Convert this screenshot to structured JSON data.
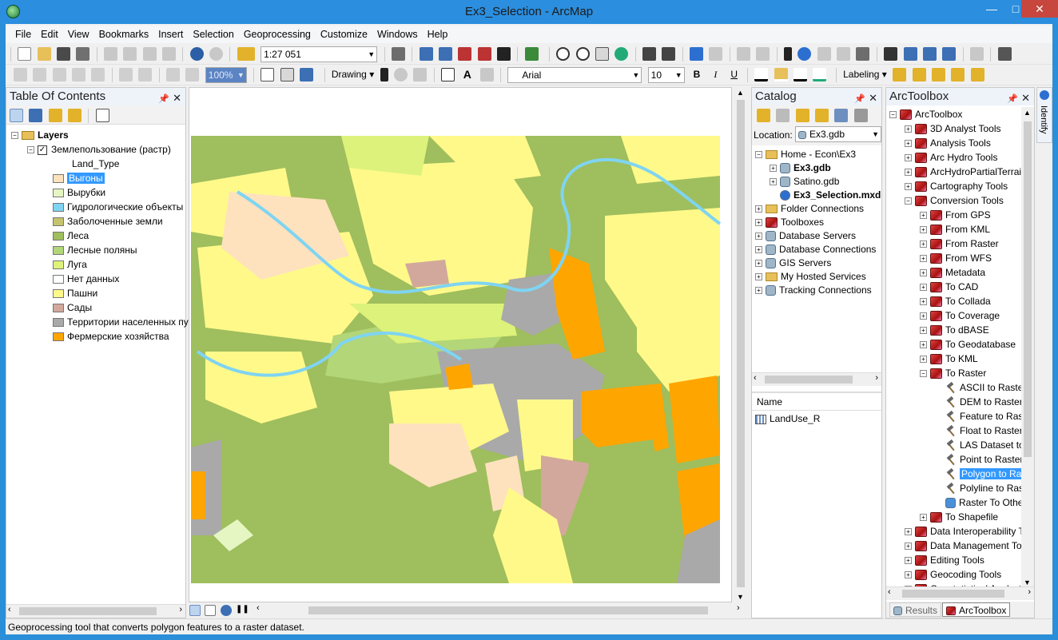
{
  "window": {
    "title": "Ex3_Selection - ArcMap",
    "minimize": "—",
    "maximize": "□",
    "close": "✕"
  },
  "menu": [
    "File",
    "Edit",
    "View",
    "Bookmarks",
    "Insert",
    "Selection",
    "Geoprocessing",
    "Customize",
    "Windows",
    "Help"
  ],
  "toolbar": {
    "scale": "1:27 051",
    "zoom_percent": "100%",
    "drawing_label": "Drawing",
    "font_name": "Arial",
    "font_size": "10",
    "bold": "B",
    "italic": "I",
    "underline": "U",
    "labeling_label": "Labeling"
  },
  "toc": {
    "title": "Table Of Contents",
    "root": "Layers",
    "layer": "Землепользование (растр)",
    "field": "Land_Type",
    "classes": [
      {
        "label": "Выгоны",
        "color": "#fde2bd"
      },
      {
        "label": "Вырубки",
        "color": "#e5f6c2"
      },
      {
        "label": "Гидрологические объекты",
        "color": "#7fd4f2"
      },
      {
        "label": "Заболоченные земли",
        "color": "#c5c46c"
      },
      {
        "label": "Леса",
        "color": "#9fbe5d"
      },
      {
        "label": "Лесные поляны",
        "color": "#b2d678"
      },
      {
        "label": "Луга",
        "color": "#ddf27a"
      },
      {
        "label": "Нет данных",
        "color": "#ffffff"
      },
      {
        "label": "Пашни",
        "color": "#fff98a"
      },
      {
        "label": "Сады",
        "color": "#d2a89c"
      },
      {
        "label": "Территории населенных пунктов",
        "color": "#a9a9a9"
      },
      {
        "label": "Фермерские хозяйства",
        "color": "#ffa500"
      }
    ]
  },
  "catalog": {
    "title": "Catalog",
    "location_label": "Location:",
    "location_value": "Ex3.gdb",
    "tree": [
      {
        "label": "Home - Econ\\Ex3",
        "level": 0,
        "expand": "−",
        "icon": "folder-icon"
      },
      {
        "label": "Ex3.gdb",
        "level": 1,
        "expand": "+",
        "icon": "geodatabase-icon",
        "bold": true
      },
      {
        "label": "Satino.gdb",
        "level": 1,
        "expand": "+",
        "icon": "geodatabase-icon"
      },
      {
        "label": "Ex3_Selection.mxd",
        "level": 1,
        "expand": "",
        "icon": "map-document-icon",
        "bold": true
      },
      {
        "label": "Folder Connections",
        "level": 0,
        "expand": "+",
        "icon": "folder-icon"
      },
      {
        "label": "Toolboxes",
        "level": 0,
        "expand": "+",
        "icon": "toolbox-icon"
      },
      {
        "label": "Database Servers",
        "level": 0,
        "expand": "+",
        "icon": "server-icon"
      },
      {
        "label": "Database Connections",
        "level": 0,
        "expand": "+",
        "icon": "database-icon"
      },
      {
        "label": "GIS Servers",
        "level": 0,
        "expand": "+",
        "icon": "server-icon"
      },
      {
        "label": "My Hosted Services",
        "level": 0,
        "expand": "+",
        "icon": "folder-icon"
      },
      {
        "label": "Tracking Connections",
        "level": 0,
        "expand": "+",
        "icon": "tracking-icon"
      }
    ],
    "contents_header": "Name",
    "contents": [
      "LandUse_R"
    ]
  },
  "arctoolbox": {
    "title": "ArcToolbox",
    "tree": [
      {
        "label": "ArcToolbox",
        "level": 0,
        "expand": "−",
        "icon": "toolbox-icon"
      },
      {
        "label": "3D Analyst Tools",
        "level": 1,
        "expand": "+",
        "icon": "toolbox-icon"
      },
      {
        "label": "Analysis Tools",
        "level": 1,
        "expand": "+",
        "icon": "toolbox-icon"
      },
      {
        "label": "Arc Hydro Tools",
        "level": 1,
        "expand": "+",
        "icon": "toolbox-icon"
      },
      {
        "label": "ArcHydroPartialTerrain",
        "level": 1,
        "expand": "+",
        "icon": "toolbox-icon"
      },
      {
        "label": "Cartography Tools",
        "level": 1,
        "expand": "+",
        "icon": "toolbox-icon"
      },
      {
        "label": "Conversion Tools",
        "level": 1,
        "expand": "−",
        "icon": "toolbox-icon"
      },
      {
        "label": "From GPS",
        "level": 2,
        "expand": "+",
        "icon": "toolset-icon"
      },
      {
        "label": "From KML",
        "level": 2,
        "expand": "+",
        "icon": "toolset-icon"
      },
      {
        "label": "From Raster",
        "level": 2,
        "expand": "+",
        "icon": "toolset-icon"
      },
      {
        "label": "From WFS",
        "level": 2,
        "expand": "+",
        "icon": "toolset-icon"
      },
      {
        "label": "Metadata",
        "level": 2,
        "expand": "+",
        "icon": "toolset-icon"
      },
      {
        "label": "To CAD",
        "level": 2,
        "expand": "+",
        "icon": "toolset-icon"
      },
      {
        "label": "To Collada",
        "level": 2,
        "expand": "+",
        "icon": "toolset-icon"
      },
      {
        "label": "To Coverage",
        "level": 2,
        "expand": "+",
        "icon": "toolset-icon"
      },
      {
        "label": "To dBASE",
        "level": 2,
        "expand": "+",
        "icon": "toolset-icon"
      },
      {
        "label": "To Geodatabase",
        "level": 2,
        "expand": "+",
        "icon": "toolset-icon"
      },
      {
        "label": "To KML",
        "level": 2,
        "expand": "+",
        "icon": "toolset-icon"
      },
      {
        "label": "To Raster",
        "level": 2,
        "expand": "−",
        "icon": "toolset-icon"
      },
      {
        "label": "ASCII to Raster",
        "level": 3,
        "expand": "",
        "icon": "hammer-icon"
      },
      {
        "label": "DEM to Raster",
        "level": 3,
        "expand": "",
        "icon": "hammer-icon"
      },
      {
        "label": "Feature to Raster",
        "level": 3,
        "expand": "",
        "icon": "hammer-icon"
      },
      {
        "label": "Float to Raster",
        "level": 3,
        "expand": "",
        "icon": "hammer-icon"
      },
      {
        "label": "LAS Dataset to Raster",
        "level": 3,
        "expand": "",
        "icon": "hammer-icon"
      },
      {
        "label": "Point to Raster",
        "level": 3,
        "expand": "",
        "icon": "hammer-icon"
      },
      {
        "label": "Polygon to Raster",
        "level": 3,
        "expand": "",
        "icon": "hammer-icon",
        "selected": true
      },
      {
        "label": "Polyline to Raster",
        "level": 3,
        "expand": "",
        "icon": "hammer-icon"
      },
      {
        "label": "Raster To Other Format",
        "level": 3,
        "expand": "",
        "icon": "script-icon"
      },
      {
        "label": "To Shapefile",
        "level": 2,
        "expand": "+",
        "icon": "toolset-icon"
      },
      {
        "label": "Data Interoperability Tools",
        "level": 1,
        "expand": "+",
        "icon": "toolbox-icon"
      },
      {
        "label": "Data Management Tools",
        "level": 1,
        "expand": "+",
        "icon": "toolbox-icon"
      },
      {
        "label": "Editing Tools",
        "level": 1,
        "expand": "+",
        "icon": "toolbox-icon"
      },
      {
        "label": "Geocoding Tools",
        "level": 1,
        "expand": "+",
        "icon": "toolbox-icon"
      },
      {
        "label": "Geostatistical Analyst Tools",
        "level": 1,
        "expand": "+",
        "icon": "toolbox-icon"
      }
    ],
    "tabs": [
      "Results",
      "ArcToolbox"
    ]
  },
  "side_tab": "Identify",
  "status": "Geoprocessing tool that converts polygon features to a raster dataset."
}
